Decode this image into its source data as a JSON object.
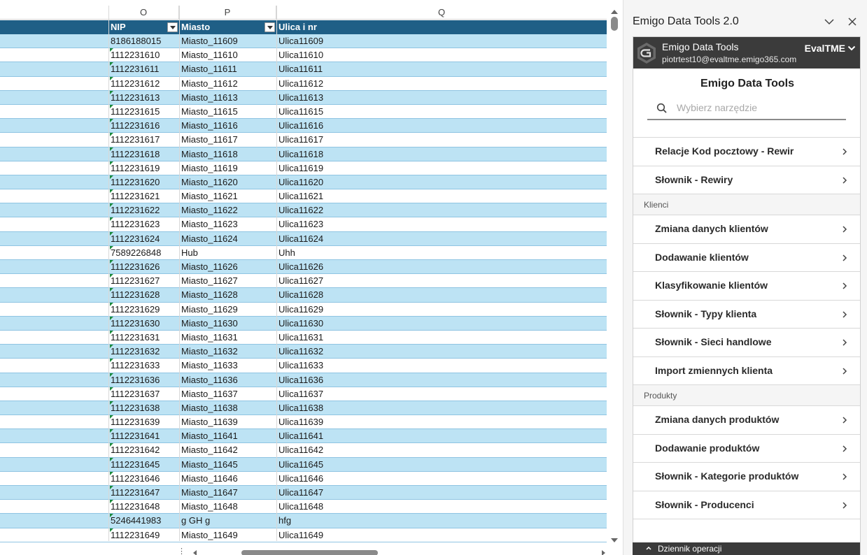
{
  "sheet": {
    "col_letters": [
      "O",
      "P",
      "Q"
    ],
    "headers": [
      "NIP",
      "Miasto",
      "Ulica i nr"
    ],
    "rows": [
      [
        "8186188015",
        "Miasto_11609",
        "Ulica11609"
      ],
      [
        "1112231610",
        "Miasto_11610",
        "Ulica11610"
      ],
      [
        "1112231611",
        "Miasto_11611",
        "Ulica11611"
      ],
      [
        "1112231612",
        "Miasto_11612",
        "Ulica11612"
      ],
      [
        "1112231613",
        "Miasto_11613",
        "Ulica11613"
      ],
      [
        "1112231615",
        "Miasto_11615",
        "Ulica11615"
      ],
      [
        "1112231616",
        "Miasto_11616",
        "Ulica11616"
      ],
      [
        "1112231617",
        "Miasto_11617",
        "Ulica11617"
      ],
      [
        "1112231618",
        "Miasto_11618",
        "Ulica11618"
      ],
      [
        "1112231619",
        "Miasto_11619",
        "Ulica11619"
      ],
      [
        "1112231620",
        "Miasto_11620",
        "Ulica11620"
      ],
      [
        "1112231621",
        "Miasto_11621",
        "Ulica11621"
      ],
      [
        "1112231622",
        "Miasto_11622",
        "Ulica11622"
      ],
      [
        "1112231623",
        "Miasto_11623",
        "Ulica11623"
      ],
      [
        "1112231624",
        "Miasto_11624",
        "Ulica11624"
      ],
      [
        "7589226848",
        "Hub",
        "Uhh"
      ],
      [
        "1112231626",
        "Miasto_11626",
        "Ulica11626"
      ],
      [
        "1112231627",
        "Miasto_11627",
        "Ulica11627"
      ],
      [
        "1112231628",
        "Miasto_11628",
        "Ulica11628"
      ],
      [
        "1112231629",
        "Miasto_11629",
        "Ulica11629"
      ],
      [
        "1112231630",
        "Miasto_11630",
        "Ulica11630"
      ],
      [
        "1112231631",
        "Miasto_11631",
        "Ulica11631"
      ],
      [
        "1112231632",
        "Miasto_11632",
        "Ulica11632"
      ],
      [
        "1112231633",
        "Miasto_11633",
        "Ulica11633"
      ],
      [
        "1112231636",
        "Miasto_11636",
        "Ulica11636"
      ],
      [
        "1112231637",
        "Miasto_11637",
        "Ulica11637"
      ],
      [
        "1112231638",
        "Miasto_11638",
        "Ulica11638"
      ],
      [
        "1112231639",
        "Miasto_11639",
        "Ulica11639"
      ],
      [
        "1112231641",
        "Miasto_11641",
        "Ulica11641"
      ],
      [
        "1112231642",
        "Miasto_11642",
        "Ulica11642"
      ],
      [
        "1112231645",
        "Miasto_11645",
        "Ulica11645"
      ],
      [
        "1112231646",
        "Miasto_11646",
        "Ulica11646"
      ],
      [
        "1112231647",
        "Miasto_11647",
        "Ulica11647"
      ],
      [
        "1112231648",
        "Miasto_11648",
        "Ulica11648"
      ],
      [
        "5246441983",
        "g GH g",
        "hfg"
      ],
      [
        "1112231649",
        "Miasto_11649",
        "Ulica11649"
      ]
    ],
    "colors": {
      "header": "#1f5f86",
      "band": "#bde3f4",
      "error_marker": "#1a8a3a"
    }
  },
  "panel": {
    "title": "Emigo Data Tools 2.0",
    "collapse_icon": "chevron-down-icon",
    "close_icon": "close-icon",
    "account": {
      "app_name": "Emigo Data Tools",
      "email": "piotrtest10@evaltme.emigo365.com",
      "environment": "EvalTME"
    },
    "tools_title": "Emigo Data Tools",
    "search": {
      "placeholder": "Wybierz narzędzie",
      "value": ""
    },
    "groups": [
      {
        "section": "",
        "items": [
          "Relacje Kod pocztowy - Rewir",
          "Słownik - Rewiry"
        ]
      },
      {
        "section": "Klienci",
        "items": [
          "Zmiana danych klientów",
          "Dodawanie klientów",
          "Klasyfikowanie klientów",
          "Słownik - Typy klienta",
          "Słownik - Sieci handlowe",
          "Import zmiennych klienta"
        ]
      },
      {
        "section": "Produkty",
        "items": [
          "Zmiana danych produktów",
          "Dodawanie produktów",
          "Słownik - Kategorie produktów",
          "Słownik - Producenci"
        ]
      }
    ],
    "log_label": "Dziennik operacji",
    "colors": {
      "dark_bar": "#3b3b3b",
      "panel_bg": "#f5f5f5"
    }
  }
}
